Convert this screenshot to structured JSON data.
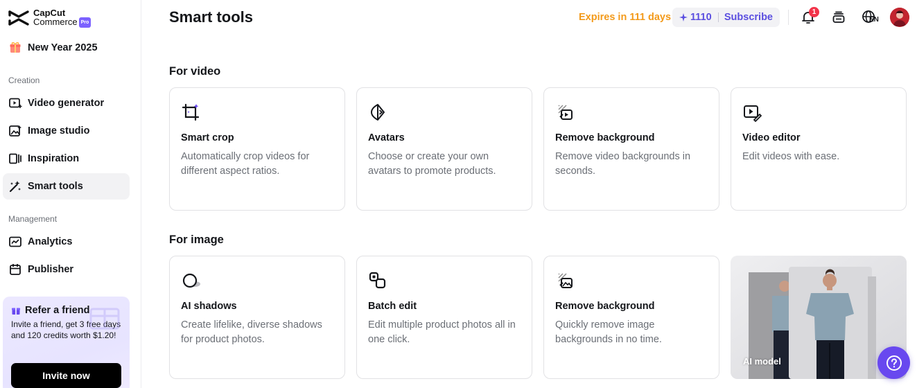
{
  "brand": {
    "name_line1": "CapCut",
    "name_line2": "Commerce",
    "badge": "Pro"
  },
  "sidebar": {
    "promo": {
      "label": "New Year 2025",
      "icon": "gift-icon"
    },
    "creation_label": "Creation",
    "creation_items": [
      {
        "label": "Video generator",
        "icon": "video-generator-icon"
      },
      {
        "label": "Image studio",
        "icon": "image-studio-icon"
      },
      {
        "label": "Inspiration",
        "icon": "inspiration-icon"
      },
      {
        "label": "Smart tools",
        "icon": "magic-wand-icon",
        "active": true
      }
    ],
    "management_label": "Management",
    "management_items": [
      {
        "label": "Analytics",
        "icon": "analytics-icon"
      },
      {
        "label": "Publisher",
        "icon": "calendar-icon"
      }
    ],
    "refer": {
      "title": "Refer a friend",
      "description": "Invite a friend, get 3 free days and 120 credits worth $1.20!",
      "button": "Invite now"
    }
  },
  "header": {
    "title": "Smart tools",
    "expires": "Expires in 111 days",
    "credits": "1110",
    "subscribe": "Subscribe",
    "notification_count": "1",
    "language": "EN"
  },
  "sections": {
    "video": {
      "title": "For video",
      "cards": [
        {
          "title": "Smart crop",
          "description": "Automatically crop videos for different aspect ratios.",
          "icon": "crop-icon"
        },
        {
          "title": "Avatars",
          "description": "Choose or create your own avatars to promote products.",
          "icon": "avatar-icon"
        },
        {
          "title": "Remove background",
          "description": "Remove video backgrounds in seconds.",
          "icon": "remove-bg-video-icon"
        },
        {
          "title": "Video editor",
          "description": "Edit videos with ease.",
          "icon": "video-editor-icon"
        }
      ]
    },
    "image": {
      "title": "For image",
      "cards": [
        {
          "title": "AI shadows",
          "description": "Create lifelike, diverse shadows for product photos.",
          "icon": "shadow-icon"
        },
        {
          "title": "Batch edit",
          "description": "Edit multiple product photos all in one click.",
          "icon": "batch-edit-icon"
        },
        {
          "title": "Remove background",
          "description": "Quickly remove image backgrounds in no time.",
          "icon": "remove-bg-image-icon"
        }
      ],
      "model_card": {
        "label": "AI model"
      }
    }
  },
  "colors": {
    "accent": "#6848ef",
    "expires": "#f39a1a",
    "credits": "#5b4fe0",
    "badge": "#f2344a"
  }
}
